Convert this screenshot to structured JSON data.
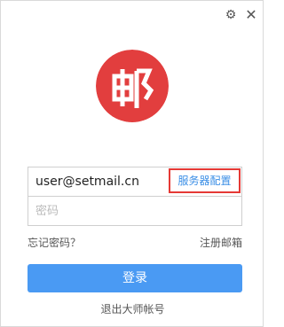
{
  "window": {
    "settings_icon": "gear-icon",
    "close_icon": "close-icon",
    "settings_glyph": "⚙",
    "close_glyph": "✕"
  },
  "logo": {
    "icon": "mail-logo-icon",
    "color": "#e23e3e"
  },
  "form": {
    "email_value": "user@setmail.cn",
    "server_config_label": "服务器配置",
    "password_placeholder": "密码"
  },
  "links": {
    "forgot_password": "忘记密码？",
    "register": "注册邮箱"
  },
  "login_button": "登录",
  "exit_master": "退出大师帐号",
  "colors": {
    "accent_blue": "#4a9af3",
    "highlight_red": "#e53935",
    "link_blue": "#3a8ee6"
  }
}
